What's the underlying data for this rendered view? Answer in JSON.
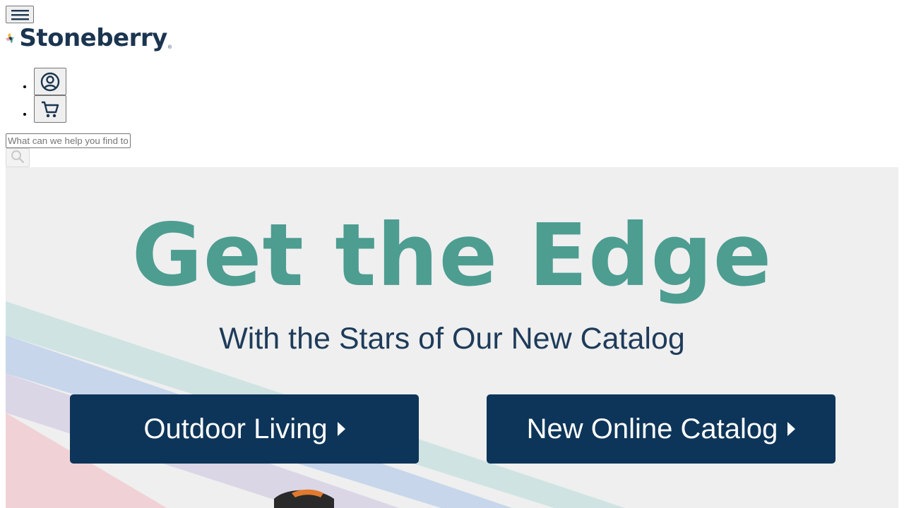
{
  "header": {
    "menu_icon": "hamburger-menu-icon",
    "logo_text": "Stoneberry",
    "logo_mark": "®",
    "brand_colors": {
      "navy": "#1b3550",
      "yellow": "#f2b928",
      "teal": "#4d9d91",
      "pink": "#e5a3a9"
    }
  },
  "utility_nav": [
    {
      "icon": "account-icon"
    },
    {
      "icon": "cart-icon"
    }
  ],
  "search": {
    "placeholder": "What can we help you find today?",
    "value": "",
    "button_icon": "search-icon"
  },
  "hero": {
    "title": "Get the Edge",
    "subtitle": "With the Stars of Our New Catalog",
    "cta_left": "Outdoor Living",
    "cta_right": "New Online Catalog",
    "colors": {
      "background": "#efefef",
      "title": "#4d9d91",
      "subtitle": "#1e3b5a",
      "button": "#0d3559"
    }
  }
}
